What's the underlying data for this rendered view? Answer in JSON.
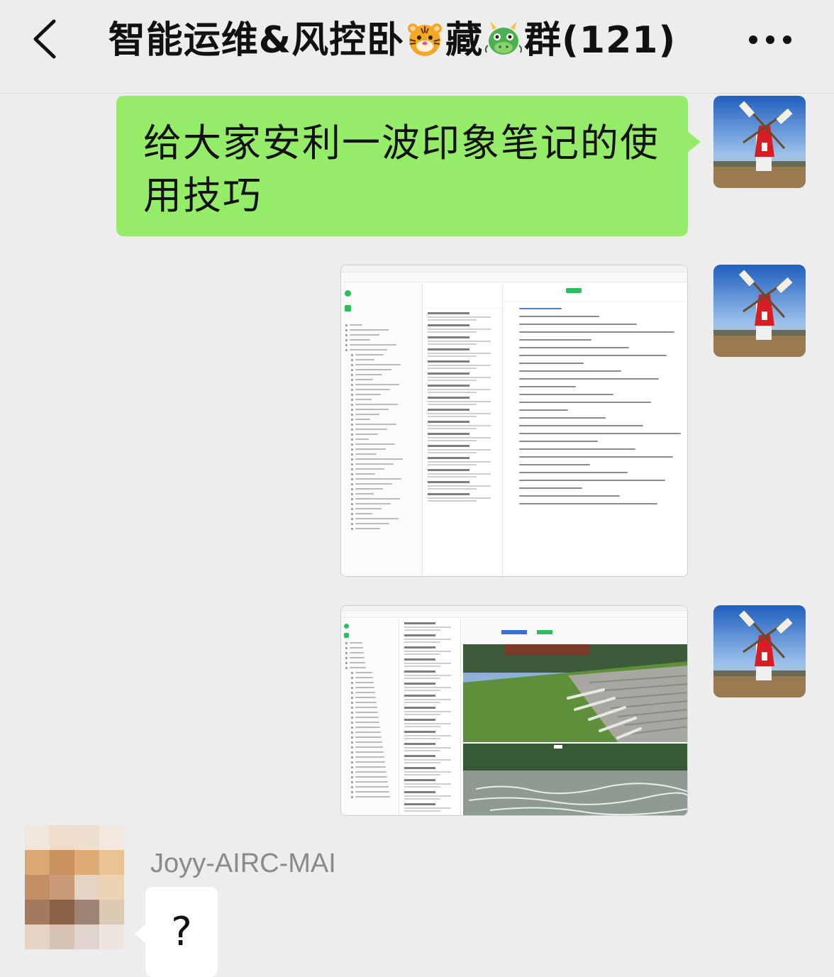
{
  "header": {
    "title_part1": "智能运维&风控卧",
    "title_part2": "藏",
    "title_part3": "群(121)",
    "emoji_1": "tiger-face-emoji",
    "emoji_2": "dragon-face-emoji",
    "back_icon": "chevron-left-icon",
    "more_icon": "more-dots-icon"
  },
  "messages": [
    {
      "type": "text",
      "from": "me",
      "text": "给大家安利一波印象笔记的使用技巧"
    },
    {
      "type": "image",
      "from": "me",
      "image_name": "evernote-notes-screenshot"
    },
    {
      "type": "image",
      "from": "me",
      "image_name": "evernote-photo-note-screenshot"
    }
  ],
  "other": {
    "sender_name": "Joyy-AIRC-MAI",
    "reply_text": "?"
  },
  "colors": {
    "background": "#ededed",
    "my_bubble": "#95ec69",
    "other_bubble": "#ffffff",
    "accent_green": "#2dbe60"
  }
}
